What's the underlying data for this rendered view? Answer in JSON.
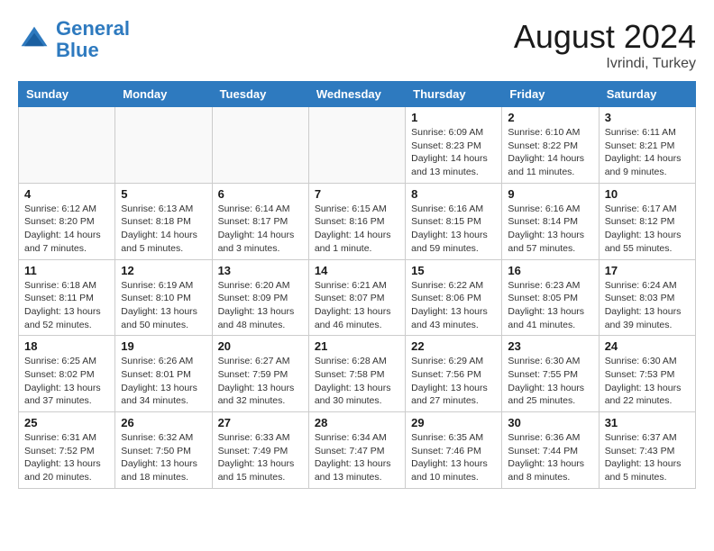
{
  "header": {
    "logo_line1": "General",
    "logo_line2": "Blue",
    "month": "August 2024",
    "location": "Ivrindi, Turkey"
  },
  "weekdays": [
    "Sunday",
    "Monday",
    "Tuesday",
    "Wednesday",
    "Thursday",
    "Friday",
    "Saturday"
  ],
  "weeks": [
    [
      {
        "day": "",
        "info": ""
      },
      {
        "day": "",
        "info": ""
      },
      {
        "day": "",
        "info": ""
      },
      {
        "day": "",
        "info": ""
      },
      {
        "day": "1",
        "info": "Sunrise: 6:09 AM\nSunset: 8:23 PM\nDaylight: 14 hours\nand 13 minutes."
      },
      {
        "day": "2",
        "info": "Sunrise: 6:10 AM\nSunset: 8:22 PM\nDaylight: 14 hours\nand 11 minutes."
      },
      {
        "day": "3",
        "info": "Sunrise: 6:11 AM\nSunset: 8:21 PM\nDaylight: 14 hours\nand 9 minutes."
      }
    ],
    [
      {
        "day": "4",
        "info": "Sunrise: 6:12 AM\nSunset: 8:20 PM\nDaylight: 14 hours\nand 7 minutes."
      },
      {
        "day": "5",
        "info": "Sunrise: 6:13 AM\nSunset: 8:18 PM\nDaylight: 14 hours\nand 5 minutes."
      },
      {
        "day": "6",
        "info": "Sunrise: 6:14 AM\nSunset: 8:17 PM\nDaylight: 14 hours\nand 3 minutes."
      },
      {
        "day": "7",
        "info": "Sunrise: 6:15 AM\nSunset: 8:16 PM\nDaylight: 14 hours\nand 1 minute."
      },
      {
        "day": "8",
        "info": "Sunrise: 6:16 AM\nSunset: 8:15 PM\nDaylight: 13 hours\nand 59 minutes."
      },
      {
        "day": "9",
        "info": "Sunrise: 6:16 AM\nSunset: 8:14 PM\nDaylight: 13 hours\nand 57 minutes."
      },
      {
        "day": "10",
        "info": "Sunrise: 6:17 AM\nSunset: 8:12 PM\nDaylight: 13 hours\nand 55 minutes."
      }
    ],
    [
      {
        "day": "11",
        "info": "Sunrise: 6:18 AM\nSunset: 8:11 PM\nDaylight: 13 hours\nand 52 minutes."
      },
      {
        "day": "12",
        "info": "Sunrise: 6:19 AM\nSunset: 8:10 PM\nDaylight: 13 hours\nand 50 minutes."
      },
      {
        "day": "13",
        "info": "Sunrise: 6:20 AM\nSunset: 8:09 PM\nDaylight: 13 hours\nand 48 minutes."
      },
      {
        "day": "14",
        "info": "Sunrise: 6:21 AM\nSunset: 8:07 PM\nDaylight: 13 hours\nand 46 minutes."
      },
      {
        "day": "15",
        "info": "Sunrise: 6:22 AM\nSunset: 8:06 PM\nDaylight: 13 hours\nand 43 minutes."
      },
      {
        "day": "16",
        "info": "Sunrise: 6:23 AM\nSunset: 8:05 PM\nDaylight: 13 hours\nand 41 minutes."
      },
      {
        "day": "17",
        "info": "Sunrise: 6:24 AM\nSunset: 8:03 PM\nDaylight: 13 hours\nand 39 minutes."
      }
    ],
    [
      {
        "day": "18",
        "info": "Sunrise: 6:25 AM\nSunset: 8:02 PM\nDaylight: 13 hours\nand 37 minutes."
      },
      {
        "day": "19",
        "info": "Sunrise: 6:26 AM\nSunset: 8:01 PM\nDaylight: 13 hours\nand 34 minutes."
      },
      {
        "day": "20",
        "info": "Sunrise: 6:27 AM\nSunset: 7:59 PM\nDaylight: 13 hours\nand 32 minutes."
      },
      {
        "day": "21",
        "info": "Sunrise: 6:28 AM\nSunset: 7:58 PM\nDaylight: 13 hours\nand 30 minutes."
      },
      {
        "day": "22",
        "info": "Sunrise: 6:29 AM\nSunset: 7:56 PM\nDaylight: 13 hours\nand 27 minutes."
      },
      {
        "day": "23",
        "info": "Sunrise: 6:30 AM\nSunset: 7:55 PM\nDaylight: 13 hours\nand 25 minutes."
      },
      {
        "day": "24",
        "info": "Sunrise: 6:30 AM\nSunset: 7:53 PM\nDaylight: 13 hours\nand 22 minutes."
      }
    ],
    [
      {
        "day": "25",
        "info": "Sunrise: 6:31 AM\nSunset: 7:52 PM\nDaylight: 13 hours\nand 20 minutes."
      },
      {
        "day": "26",
        "info": "Sunrise: 6:32 AM\nSunset: 7:50 PM\nDaylight: 13 hours\nand 18 minutes."
      },
      {
        "day": "27",
        "info": "Sunrise: 6:33 AM\nSunset: 7:49 PM\nDaylight: 13 hours\nand 15 minutes."
      },
      {
        "day": "28",
        "info": "Sunrise: 6:34 AM\nSunset: 7:47 PM\nDaylight: 13 hours\nand 13 minutes."
      },
      {
        "day": "29",
        "info": "Sunrise: 6:35 AM\nSunset: 7:46 PM\nDaylight: 13 hours\nand 10 minutes."
      },
      {
        "day": "30",
        "info": "Sunrise: 6:36 AM\nSunset: 7:44 PM\nDaylight: 13 hours\nand 8 minutes."
      },
      {
        "day": "31",
        "info": "Sunrise: 6:37 AM\nSunset: 7:43 PM\nDaylight: 13 hours\nand 5 minutes."
      }
    ]
  ]
}
